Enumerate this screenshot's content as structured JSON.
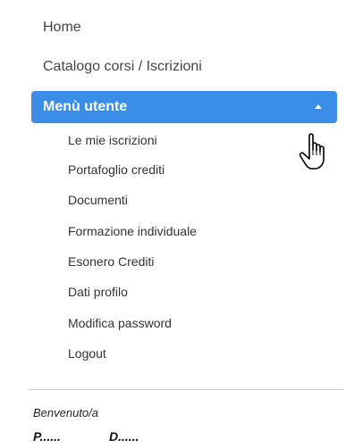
{
  "nav": {
    "home": "Home",
    "catalog": "Catalogo corsi / Iscrizioni",
    "user_menu": {
      "label": "Menù utente",
      "expanded": true,
      "accent_color": "#3a8ee6",
      "items": [
        "Le mie iscrizioni",
        "Portafoglio crediti",
        "Documenti",
        "Formazione individuale",
        "Esonero Crediti",
        "Dati profilo",
        "Modifica password",
        "Logout"
      ]
    }
  },
  "user": {
    "welcome": "Benvenuto/a",
    "first": "P......",
    "last": "D......"
  },
  "icons": {
    "caret": "caret-up-icon",
    "cursor": "hand-pointer-icon"
  }
}
